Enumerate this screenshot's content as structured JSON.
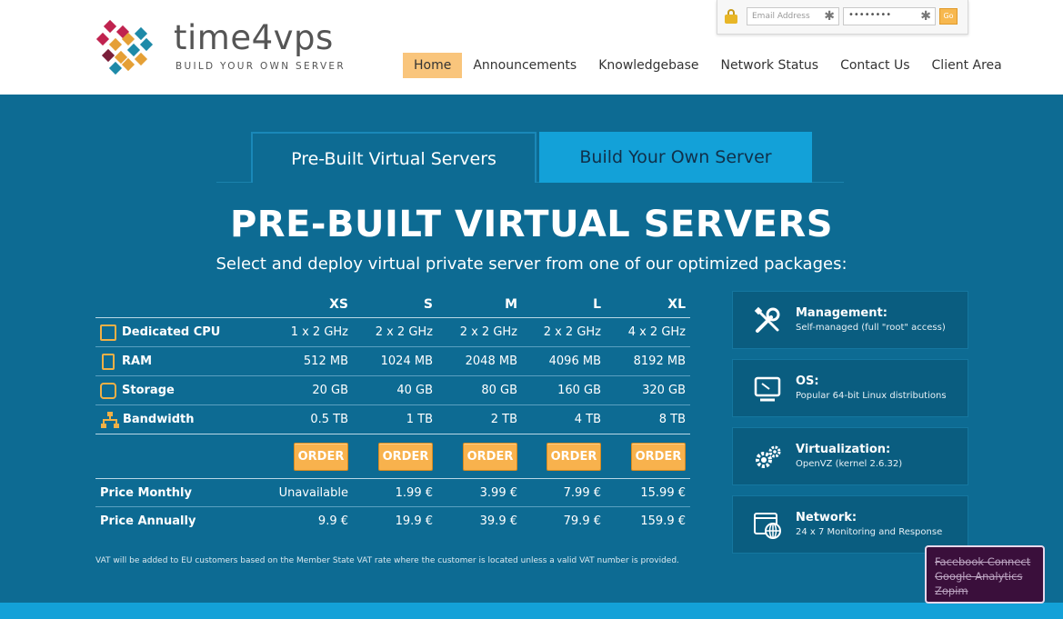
{
  "brand": {
    "name": "time4vps",
    "tagline": "BUILD YOUR OWN SERVER"
  },
  "login": {
    "email_placeholder": "Email Address",
    "password_value": "••••••••",
    "go_label": "Go",
    "required_mark": "✱"
  },
  "nav": [
    {
      "label": "Home",
      "active": true
    },
    {
      "label": "Announcements"
    },
    {
      "label": "Knowledgebase"
    },
    {
      "label": "Network Status"
    },
    {
      "label": "Contact Us"
    },
    {
      "label": "Client Area"
    }
  ],
  "tabs": [
    {
      "label": "Pre-Built Virtual Servers",
      "active": true
    },
    {
      "label": "Build Your Own Server"
    }
  ],
  "main": {
    "title": "PRE-BUILT VIRTUAL SERVERS",
    "subtitle": "Select and deploy virtual private server from one of our optimized packages:"
  },
  "plans": {
    "columns": [
      "XS",
      "S",
      "M",
      "L",
      "XL"
    ],
    "rows": [
      {
        "label": "Dedicated CPU",
        "icon": "cpu-icon",
        "values": [
          "1 x 2 GHz",
          "2 x 2 GHz",
          "2 x 2 GHz",
          "2 x 2 GHz",
          "4 x 2 GHz"
        ]
      },
      {
        "label": "RAM",
        "icon": "ram-icon",
        "values": [
          "512 MB",
          "1024 MB",
          "2048 MB",
          "4096 MB",
          "8192 MB"
        ]
      },
      {
        "label": "Storage",
        "icon": "storage-icon",
        "values": [
          "20 GB",
          "40 GB",
          "80 GB",
          "160 GB",
          "320 GB"
        ]
      },
      {
        "label": "Bandwidth",
        "icon": "bandwidth-icon",
        "values": [
          "0.5 TB",
          "1 TB",
          "2 TB",
          "4 TB",
          "8 TB"
        ]
      }
    ],
    "order_label": "ORDER",
    "prices": [
      {
        "label": "Price Monthly",
        "values": [
          "Unavailable",
          "1.99 €",
          "3.99 €",
          "7.99 €",
          "15.99 €"
        ]
      },
      {
        "label": "Price Annually",
        "values": [
          "9.9 €",
          "19.9 €",
          "39.9 €",
          "79.9 €",
          "159.9 €"
        ]
      }
    ],
    "vat_note": "VAT will be added to EU customers based on the Member State VAT rate where the customer is located unless a valid VAT number is provided."
  },
  "features": [
    {
      "title": "Management:",
      "desc": "Self-managed (full \"root\" access)",
      "icon": "tools-icon"
    },
    {
      "title": "OS:",
      "desc": "Popular 64-bit Linux distributions",
      "icon": "monitor-icon"
    },
    {
      "title": "Virtualization:",
      "desc": "OpenVZ (kernel 2.6.32)",
      "icon": "gears-icon"
    },
    {
      "title": "Network:",
      "desc": "24 x 7 Monitoring and Response",
      "icon": "network-window-icon"
    }
  ],
  "cookie_popup": {
    "items": [
      "Facebook Connect",
      "Google Analytics",
      "Zopim"
    ]
  },
  "colors": {
    "page_bg": "#0d6b93",
    "accent_orange": "#f8b24d",
    "tab_active_bg": "#13a1d8",
    "nav_active": "#f9c57c"
  }
}
